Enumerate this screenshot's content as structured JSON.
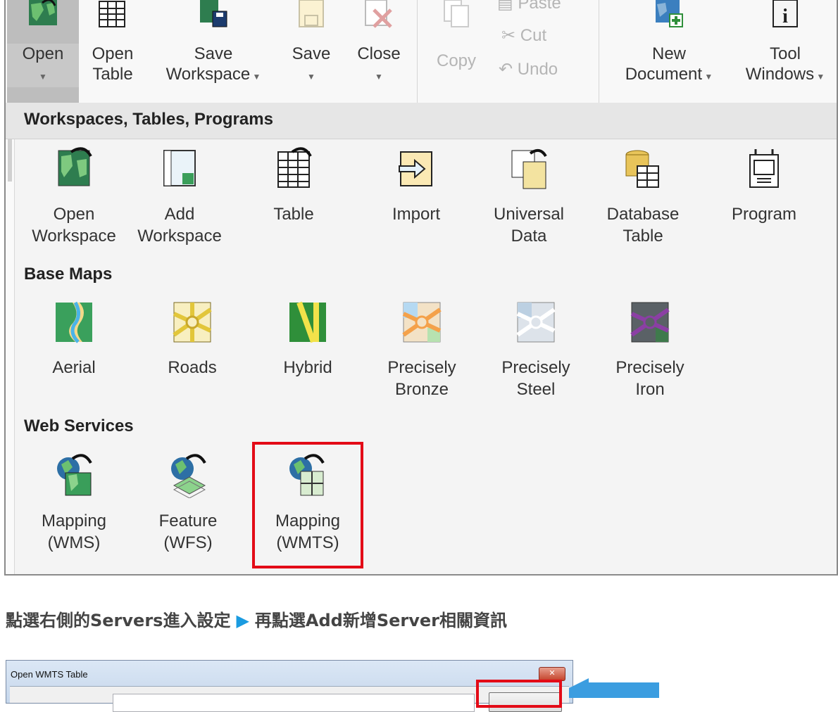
{
  "ribbon": {
    "open": "Open",
    "open_table": [
      "Open",
      "Table"
    ],
    "save_workspace": [
      "Save",
      "Workspace"
    ],
    "save": "Save",
    "close": "Close",
    "copy": "Copy",
    "paste": "Paste",
    "cut": "Cut",
    "undo": "Undo",
    "new_document": [
      "New",
      "Document"
    ],
    "tool_windows": [
      "Tool",
      "Windows"
    ]
  },
  "menu": {
    "sections": {
      "workspaces": "Workspaces, Tables, Programs",
      "basemaps": "Base Maps",
      "webservices": "Web Services"
    },
    "workspaces_items": [
      [
        "Open",
        "Workspace"
      ],
      [
        "Add",
        "Workspace"
      ],
      [
        "Table",
        ""
      ],
      [
        "Import",
        ""
      ],
      [
        "Universal",
        "Data"
      ],
      [
        "Database",
        "Table"
      ],
      [
        "Program",
        ""
      ]
    ],
    "basemap_items": [
      [
        "Aerial",
        ""
      ],
      [
        "Roads",
        ""
      ],
      [
        "Hybrid",
        ""
      ],
      [
        "Precisely",
        "Bronze"
      ],
      [
        "Precisely",
        "Steel"
      ],
      [
        "Precisely",
        "Iron"
      ]
    ],
    "web_items": [
      [
        "Mapping",
        "(WMS)"
      ],
      [
        "Feature",
        "(WFS)"
      ],
      [
        "Mapping",
        "(WMTS)"
      ]
    ]
  },
  "caption": {
    "part1": "點選右側的Servers進入設定",
    "part2": "再點選Add新增Server相關資訊"
  },
  "dialog": {
    "title": "Open WMTS Table"
  },
  "colors": {
    "highlight": "#e30b17",
    "arrow": "#1a9be0",
    "map_green": "#3a9e5a",
    "map_blue": "#2d6fa5"
  }
}
